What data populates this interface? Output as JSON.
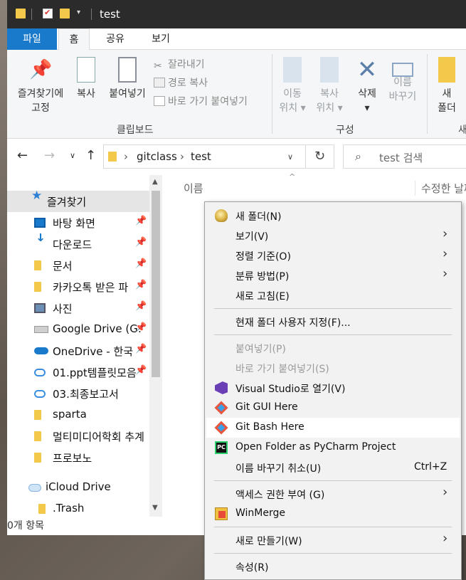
{
  "window": {
    "title": "test"
  },
  "ribbon_tabs": {
    "file": "파일",
    "home": "홈",
    "share": "공유",
    "view": "보기"
  },
  "ribbon": {
    "pin_quick": [
      "즐겨찾기에",
      "고정"
    ],
    "copy": "복사",
    "paste": "붙여넣기",
    "cut": "잘라내기",
    "copy_path": "경로 복사",
    "paste_shortcut": "바로 가기 붙여넣기",
    "clipboard_group": "클립보드",
    "move_to": [
      "이동",
      "위치"
    ],
    "copy_to": [
      "복사",
      "위치"
    ],
    "delete": "삭제",
    "rename": [
      "이름",
      "바꾸기"
    ],
    "organize_group": "구성",
    "new_folder": [
      "새",
      "폴더"
    ],
    "new_group_partial": "새"
  },
  "address": {
    "crumbs": [
      "gitclass",
      "test"
    ],
    "search_placeholder": "test 검색"
  },
  "columns": {
    "name": "이름",
    "modified": "수정한 날짜"
  },
  "nav_pane": {
    "items": [
      {
        "label": "즐겨찾기",
        "icon": "star-icon",
        "pinned": false
      },
      {
        "label": "바탕 화면",
        "icon": "desktop-icon",
        "pinned": true
      },
      {
        "label": "다운로드",
        "icon": "download-icon",
        "pinned": true
      },
      {
        "label": "문서",
        "icon": "folder-icon",
        "pinned": true
      },
      {
        "label": "카카오톡 받은 파",
        "icon": "folder-icon",
        "pinned": true
      },
      {
        "label": "사진",
        "icon": "pictures-icon",
        "pinned": true
      },
      {
        "label": "Google Drive (G:",
        "icon": "drive-icon",
        "pinned": true
      },
      {
        "label": "OneDrive - 한국",
        "icon": "onedrive-icon",
        "pinned": true
      },
      {
        "label": "01.ppt템플릿모음",
        "icon": "cloud-folder-icon",
        "pinned": true
      },
      {
        "label": "03.최종보고서",
        "icon": "cloud-folder-icon",
        "pinned": false
      },
      {
        "label": "sparta",
        "icon": "folder-icon",
        "pinned": false
      },
      {
        "label": "멀티미디어학회 추계",
        "icon": "folder-icon",
        "pinned": false
      },
      {
        "label": "프로보노",
        "icon": "folder-icon",
        "pinned": false
      },
      {
        "label": "iCloud Drive",
        "icon": "icloud-icon",
        "pinned": false
      },
      {
        "label": ".Trash",
        "icon": "folder-icon",
        "pinned": false
      }
    ]
  },
  "status_bar": {
    "text": "0개 항목"
  },
  "context_menu": {
    "items": [
      {
        "label": "새 폴더(N)",
        "icon": "new-folder-icon"
      },
      {
        "label": "보기(V)",
        "submenu": true
      },
      {
        "label": "정렬 기준(O)",
        "submenu": true
      },
      {
        "label": "분류 방법(P)",
        "submenu": true
      },
      {
        "label": "새로 고침(E)"
      },
      {
        "label": "현재 폴더 사용자 지정(F)..."
      },
      {
        "label": "붙여넣기(P)",
        "disabled": true
      },
      {
        "label": "바로 가기 붙여넣기(S)",
        "disabled": true
      },
      {
        "label": "Visual Studio로 열기(V)",
        "icon": "visual-studio-icon"
      },
      {
        "label": "Git GUI Here",
        "icon": "git-icon"
      },
      {
        "label": "Git Bash Here",
        "icon": "git-icon",
        "highlighted": true
      },
      {
        "label": "Open Folder as PyCharm Project",
        "icon": "pycharm-icon"
      },
      {
        "label": "이름 바꾸기 취소(U)",
        "shortcut": "Ctrl+Z"
      },
      {
        "label": "액세스 권한 부여 (G)",
        "submenu": true
      },
      {
        "label": "WinMerge",
        "icon": "winmerge-icon"
      },
      {
        "label": "새로 만들기(W)",
        "submenu": true
      },
      {
        "label": "속성(R)"
      }
    ]
  }
}
